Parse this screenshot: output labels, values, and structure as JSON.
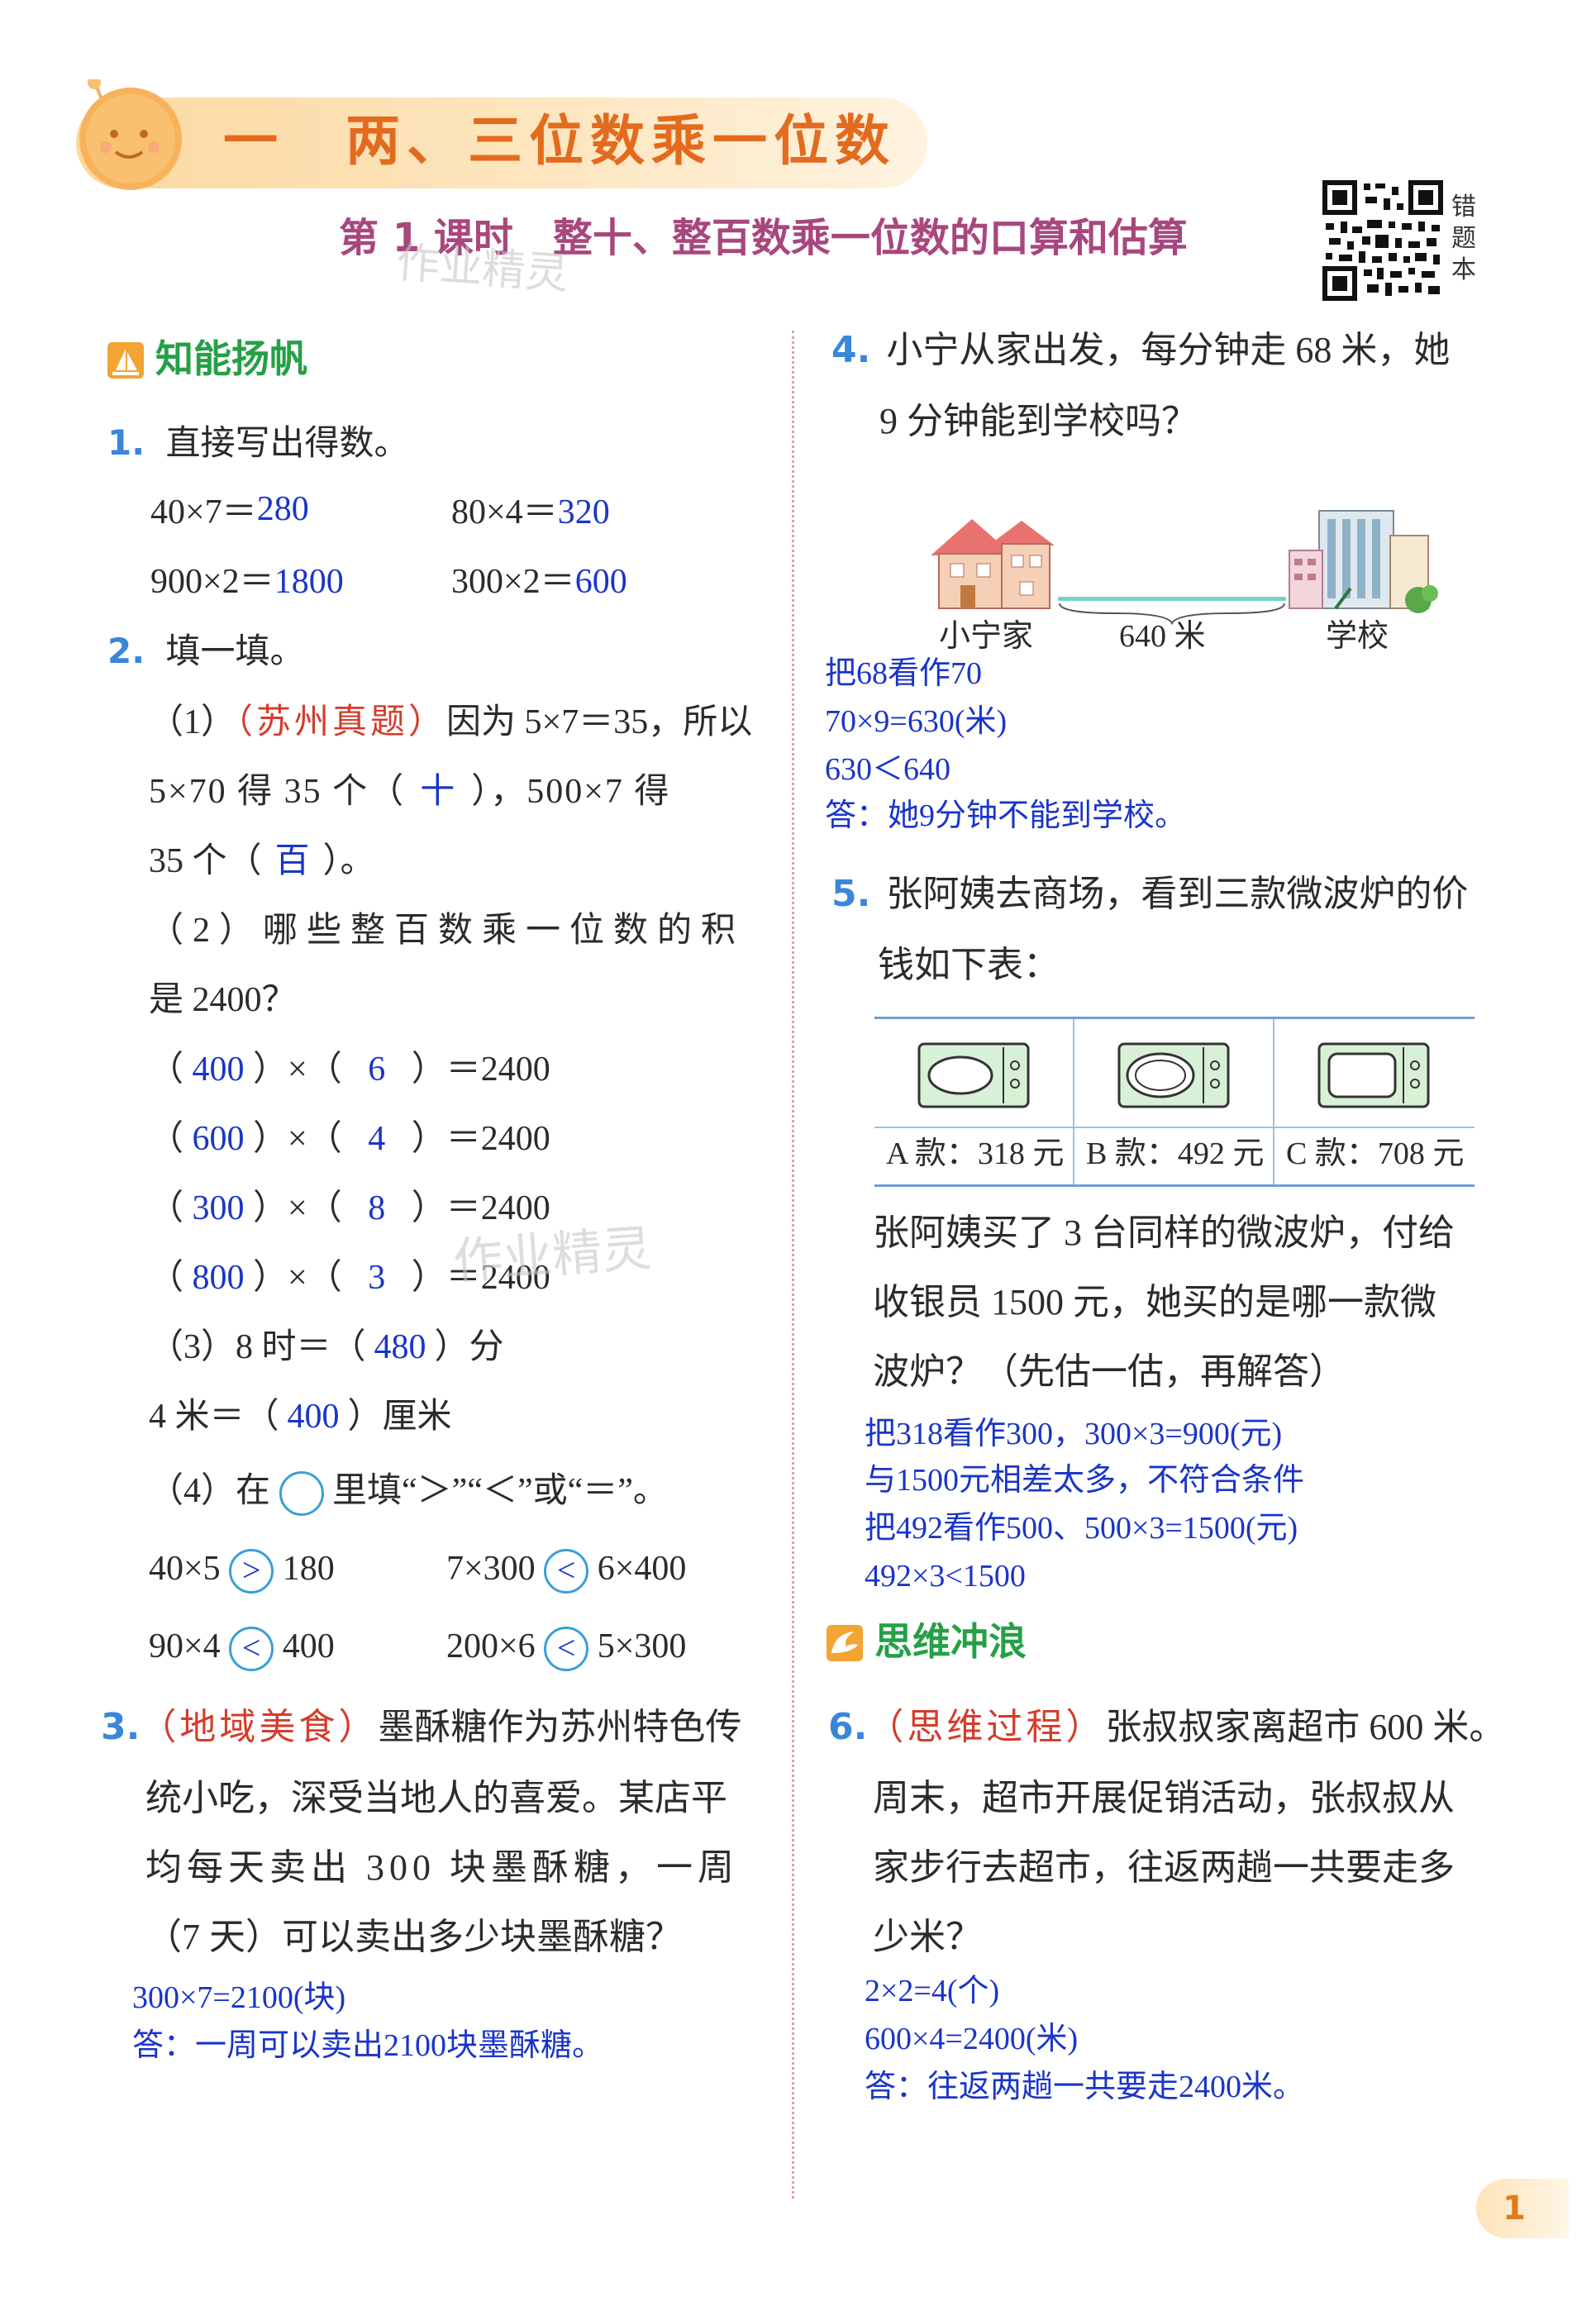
{
  "header": {
    "unit_title": "一　两、三位数乘一位数",
    "lesson_title": "第 1 课时　整十、整百数乘一位数的口算和估算",
    "qr_side_label": "错题本",
    "watermark": "作业精灵"
  },
  "section1": {
    "title": "知能扬帆"
  },
  "q1": {
    "num": "1.",
    "prompt": "直接写出得数。",
    "items": [
      {
        "expr": "40×7＝",
        "ans": "280"
      },
      {
        "expr": "80×4＝",
        "ans": "320"
      },
      {
        "expr": "900×2＝",
        "ans": "1800"
      },
      {
        "expr": "300×2＝",
        "ans": "600"
      }
    ]
  },
  "q2": {
    "num": "2.",
    "prompt": "填一填。",
    "p1_tag": "（苏州真题）",
    "p1_a": "（1）",
    "p1_b": "因为 5×7＝35，所以",
    "p1_c": "5×70 得 35 个（",
    "p1_ans1": "十",
    "p1_d": "），500×7 得",
    "p1_e": "35 个（",
    "p1_ans2": "百",
    "p1_f": "）。",
    "p2_a": "（2）哪些整百数乘一位数的积",
    "p2_b": "是 2400？",
    "p2_rows": [
      {
        "a": "400",
        "b": "6"
      },
      {
        "a": "600",
        "b": "4"
      },
      {
        "a": "300",
        "b": "8"
      },
      {
        "a": "800",
        "b": "3"
      }
    ],
    "p2_eq": "）＝2400",
    "p3_a": "（3）8 时＝（",
    "p3_ans": "480",
    "p3_b": "）分",
    "p3_c": "4 米＝（",
    "p3_ans2": "400",
    "p3_d": "）厘米",
    "p4_a": "（4）在",
    "p4_b": "里填“＞”“＜”或“＝”。",
    "compare": [
      {
        "l": "40×5",
        "s": ">",
        "r": "180"
      },
      {
        "l": "7×300",
        "s": "<",
        "r": "6×400"
      },
      {
        "l": "90×4",
        "s": "<",
        "r": "400"
      },
      {
        "l": "200×6",
        "s": "<",
        "r": "5×300"
      }
    ]
  },
  "q3": {
    "num": "3.",
    "tag": "（地域美食）",
    "l1": "墨酥糖作为苏州特色传",
    "l2": "统小吃，深受当地人的喜爱。某店平",
    "l3": "均每天卖出 300 块墨酥糖，一周",
    "l4": "（7 天）可以卖出多少块墨酥糖？",
    "a1": "300×7=2100(块)",
    "a2": "答：一周可以卖出2100块墨酥糖。"
  },
  "q4": {
    "num": "4.",
    "l1": "小宁从家出发，每分钟走 68 米，她",
    "l2": "9 分钟能到学校吗？",
    "label_home": "小宁家",
    "label_dist": "640 米",
    "label_school": "学校",
    "a1": "把68看作70",
    "a2": "70×9=630(米)",
    "a3": "630＜640",
    "a4": "答：她9分钟不能到学校。"
  },
  "q5": {
    "num": "5.",
    "l1": "张阿姨去商场，看到三款微波炉的价",
    "l2": "钱如下表：",
    "prices": [
      "A 款：318 元",
      "B 款：492 元",
      "C 款：708 元"
    ],
    "l3": "张阿姨买了 3 台同样的微波炉，付给",
    "l4": "收银员 1500 元，她买的是哪一款微",
    "l5": "波炉？（先估一估，再解答）",
    "a1": "把318看作300，300×3=900(元)",
    "a2": "与1500元相差太多，不符合条件",
    "a3": "把492看作500、500×3=1500(元)",
    "a4": "492×3<1500"
  },
  "section2": {
    "title": "思维冲浪"
  },
  "q6": {
    "num": "6.",
    "tag": "（思维过程）",
    "l1": "张叔叔家离超市 600 米。",
    "l2": "周末，超市开展促销活动，张叔叔从",
    "l3": "家步行去超市，往返两趟一共要走多",
    "l4": "少米？",
    "a1": "2×2=4(个)",
    "a2": "600×4=2400(米)",
    "a3": "答：往返两趟一共要走2400米。"
  },
  "page_number": "1"
}
